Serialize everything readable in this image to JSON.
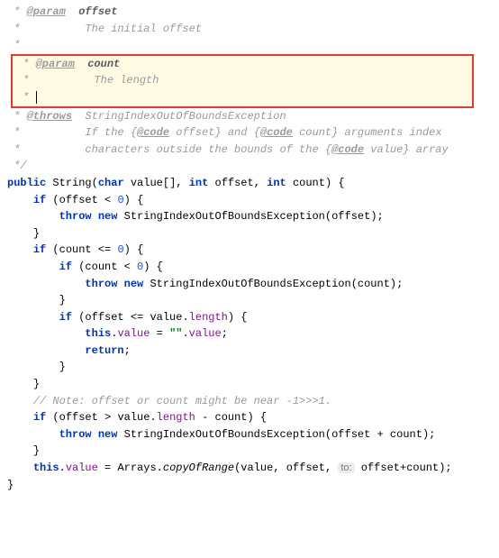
{
  "doc": {
    "star": " * ",
    "star_empty": " *",
    "param_tag": "@param",
    "throws_tag": "@throws",
    "code_tag": "@code",
    "offset_name": "offset",
    "offset_desc": "The initial offset",
    "count_name": "count",
    "count_desc": "The length",
    "throws_type": "IndexOutOfBoundsException",
    "throws_line1a": "If the {",
    "throws_line1b": " offset} and {",
    "throws_line1c": " count} arguments index",
    "throws_line2a": "characters outside the bounds of the {",
    "throws_line2b": " value} array",
    "end": " */"
  },
  "kw": {
    "public": "public",
    "char": "char",
    "int": "int",
    "if": "if",
    "throw": "throw",
    "new": "new",
    "this": "this",
    "return": "return"
  },
  "ids": {
    "String": "String",
    "value": "value",
    "offset": "offset",
    "count": "count",
    "length": "length",
    "Arrays": "Arrays",
    "copyOfRange": "copyOfRange",
    "ex": "StringIndexOutOfBoundsException"
  },
  "syms": {
    "lparen": "(",
    "rparen": ")",
    "lbrace": "{",
    "rbrace": "}",
    "lbracket": "[",
    "rbracket": "]",
    "comma": ", ",
    "semi": ";",
    "lt": " < ",
    "lte": " <= ",
    "gt": " > ",
    "minus": " - ",
    "plus": " + ",
    "plus2": "+",
    "eq": " = ",
    "dot": "."
  },
  "nums": {
    "zero": "0"
  },
  "str": {
    "empty": "\"\""
  },
  "cmt": {
    "note": "// Note: offset or count might be near -1>>>1."
  },
  "hints": {
    "to": "to:"
  },
  "caret": "|"
}
